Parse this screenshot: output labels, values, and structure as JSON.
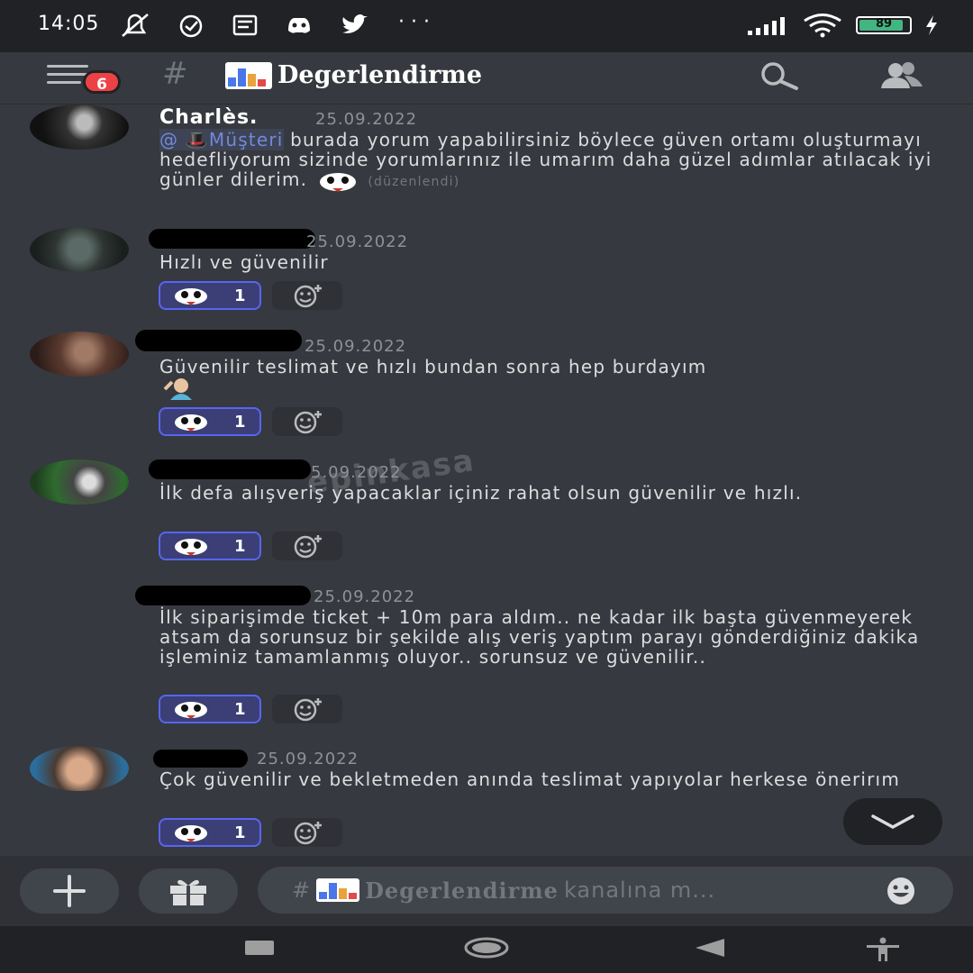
{
  "status_bar": {
    "time": "14:05",
    "battery": "89",
    "battery_fraction": 0.89,
    "icons": [
      "muted-bell-icon",
      "alarm-icon",
      "news-icon",
      "discord-icon",
      "twitter-icon",
      "more-dots-icon",
      "signal-icon",
      "wifi-icon",
      "battery-icon",
      "charging-icon"
    ]
  },
  "header": {
    "hash": "#",
    "channel_name": "Degerlendirme",
    "notification_count": "6"
  },
  "watermark": "epinkasa",
  "messages": [
    {
      "username": "Charlès.",
      "timestamp": "25.09.2022",
      "mention": "@ 🎩Müşteri",
      "text": " burada yorum yapabilirsiniz böylece güven ortamı oluşturmayı hedefliyorum sizinde yorumlarınız ile umarım daha güzel adımlar atılacak iyi günler dilerim.",
      "edited": "(düzenlendi)"
    },
    {
      "timestamp": "25.09.2022",
      "text": "Hızlı ve güvenilir",
      "reaction_count": "1"
    },
    {
      "timestamp": "25.09.2022",
      "text": "Güvenilir teslimat ve hızlı bundan sonra hep burdayım",
      "reaction_count": "1"
    },
    {
      "timestamp": "5.09.2022",
      "text": "İlk defa alışveriş yapacaklar içiniz rahat olsun güvenilir ve hızlı.",
      "reaction_count": "1"
    },
    {
      "timestamp": "25.09.2022",
      "text": "İlk siparişimde ticket + 10m para aldım.. ne kadar ilk başta güvenmeyerek atsam da sorunsuz bir şekilde alış veriş yaptım parayı gönderdiğiniz dakika işleminiz tamamlanmış oluyor.. sorunsuz ve güvenilir..",
      "reaction_count": "1"
    },
    {
      "timestamp": "25.09.2022",
      "text": "Çok güvenilir ve bekletmeden anında teslimat yapıyolar herkese önerirım",
      "reaction_count": "1"
    }
  ],
  "composer": {
    "hash": "#",
    "channel_name": "Degerlendirme",
    "placeholder_suffix": "kanalına m..."
  },
  "colors": {
    "background": "#36393f",
    "accent": "#5865f2",
    "mention": "#7289da",
    "badge": "#ed4245"
  }
}
